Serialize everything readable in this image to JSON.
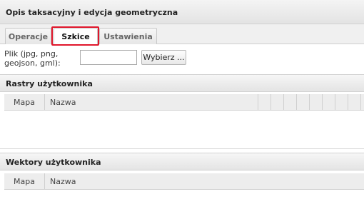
{
  "panel": {
    "title": "Opis taksacyjny i edycja geometryczna"
  },
  "tabs": [
    {
      "label": "Operacje",
      "selected": false
    },
    {
      "label": "Szkice",
      "selected": true
    },
    {
      "label": "Ustawienia",
      "selected": false
    }
  ],
  "file": {
    "label": "Plik (jpg, png, geojson, gml):",
    "value": "",
    "button_label": "Wybierz ..."
  },
  "rasters": {
    "title": "Rastry użytkownika",
    "columns": [
      "Mapa",
      "Nazwa"
    ],
    "rows": []
  },
  "vectors": {
    "title": "Wektory użytkownika",
    "columns": [
      "Mapa",
      "Nazwa"
    ],
    "rows": []
  },
  "colors": {
    "highlight": "#e0162b",
    "header_bg": "#e8e8e8"
  }
}
